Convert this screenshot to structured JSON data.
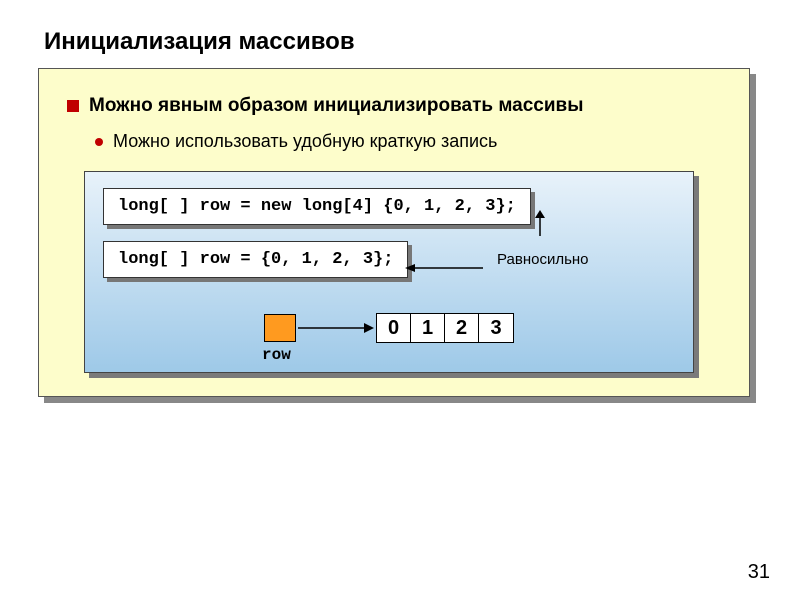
{
  "title": "Инициализация массивов",
  "bullet": "Можно явным образом инициализировать массивы",
  "sub_bullet": "Можно использовать удобную краткую запись",
  "code1": "long[ ] row = new long[4] {0, 1, 2, 3};",
  "code2": "long[ ] row = {0, 1, 2, 3};",
  "equiv_label": "Равносильно",
  "row_label": "row",
  "array": [
    "0",
    "1",
    "2",
    "3"
  ],
  "page_number": "31"
}
